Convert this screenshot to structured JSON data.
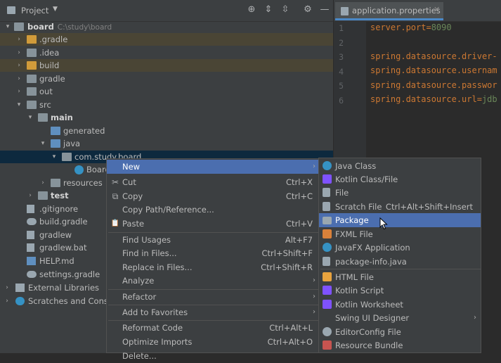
{
  "project_panel": {
    "title": "Project",
    "tree": [
      {
        "label": "board",
        "path": "C:\\study\\board",
        "bold": true
      },
      {
        "label": ".gradle"
      },
      {
        "label": ".idea"
      },
      {
        "label": "build"
      },
      {
        "label": "gradle"
      },
      {
        "label": "out"
      },
      {
        "label": "src"
      },
      {
        "label": "main",
        "bold": true
      },
      {
        "label": "generated"
      },
      {
        "label": "java"
      },
      {
        "label": "com.study.board"
      },
      {
        "label": "Board"
      },
      {
        "label": "resources"
      },
      {
        "label": "test",
        "bold": true
      },
      {
        "label": ".gitignore"
      },
      {
        "label": "build.gradle"
      },
      {
        "label": "gradlew"
      },
      {
        "label": "gradlew.bat"
      },
      {
        "label": "HELP.md"
      },
      {
        "label": "settings.gradle"
      },
      {
        "label": "External Libraries"
      },
      {
        "label": "Scratches and Consoles"
      }
    ]
  },
  "editor": {
    "tab_label": "application.properties",
    "line_numbers": [
      "1",
      "2",
      "3",
      "4",
      "5",
      "6"
    ],
    "lines": [
      {
        "key": "server.port=",
        "value": "8090"
      },
      {
        "key": "",
        "value": ""
      },
      {
        "key": "spring.datasource.driver-",
        "value": ""
      },
      {
        "key": "spring.datasource.usernam",
        "value": ""
      },
      {
        "key": "spring.datasource.passwor",
        "value": ""
      },
      {
        "key": "spring.datasource.url=",
        "value": "jdb"
      }
    ]
  },
  "context_menu": {
    "items": [
      {
        "label": "New",
        "submenu": true
      },
      {
        "label": "Cut",
        "shortcut": "Ctrl+X",
        "icon": "✂"
      },
      {
        "label": "Copy",
        "shortcut": "Ctrl+C",
        "icon": "⧉"
      },
      {
        "label": "Copy Path/Reference..."
      },
      {
        "label": "Paste",
        "shortcut": "Ctrl+V",
        "icon": "📋"
      },
      {
        "label": "Find Usages",
        "shortcut": "Alt+F7"
      },
      {
        "label": "Find in Files...",
        "shortcut": "Ctrl+Shift+F"
      },
      {
        "label": "Replace in Files...",
        "shortcut": "Ctrl+Shift+R"
      },
      {
        "label": "Analyze",
        "submenu": true
      },
      {
        "label": "Refactor",
        "submenu": true
      },
      {
        "label": "Add to Favorites",
        "submenu": true
      },
      {
        "label": "Reformat Code",
        "shortcut": "Ctrl+Alt+L"
      },
      {
        "label": "Optimize Imports",
        "shortcut": "Ctrl+Alt+O"
      },
      {
        "label": "Delete..."
      }
    ]
  },
  "new_submenu": {
    "items": [
      {
        "label": "Java Class",
        "icon_color": "#3592c4"
      },
      {
        "label": "Kotlin Class/File",
        "icon_color": "#7f52ff"
      },
      {
        "label": "File",
        "icon_color": "#9aa7b0"
      },
      {
        "label": "Scratch File",
        "shortcut": "Ctrl+Alt+Shift+Insert",
        "icon_color": "#9aa7b0"
      },
      {
        "label": "Package",
        "icon_color": "#9aa7b0"
      },
      {
        "label": "FXML File",
        "icon_color": "#d9813a"
      },
      {
        "label": "JavaFX Application",
        "icon_color": "#3592c4"
      },
      {
        "label": "package-info.java",
        "icon_color": "#9aa7b0"
      },
      {
        "label": "HTML File",
        "icon_color": "#e8a33e"
      },
      {
        "label": "Kotlin Script",
        "icon_color": "#7f52ff"
      },
      {
        "label": "Kotlin Worksheet",
        "icon_color": "#7f52ff"
      },
      {
        "label": "Swing UI Designer",
        "submenu": true
      },
      {
        "label": "EditorConfig File",
        "icon_color": "#9aa7b0"
      },
      {
        "label": "Resource Bundle",
        "icon_color": "#c75450"
      }
    ]
  },
  "colors": {
    "folder": "#87939a",
    "folder_orange": "#d19b3a",
    "source_folder": "#5f8fbf",
    "selection": "#4b6eaf",
    "excluded_highlight": "#4a4535"
  }
}
